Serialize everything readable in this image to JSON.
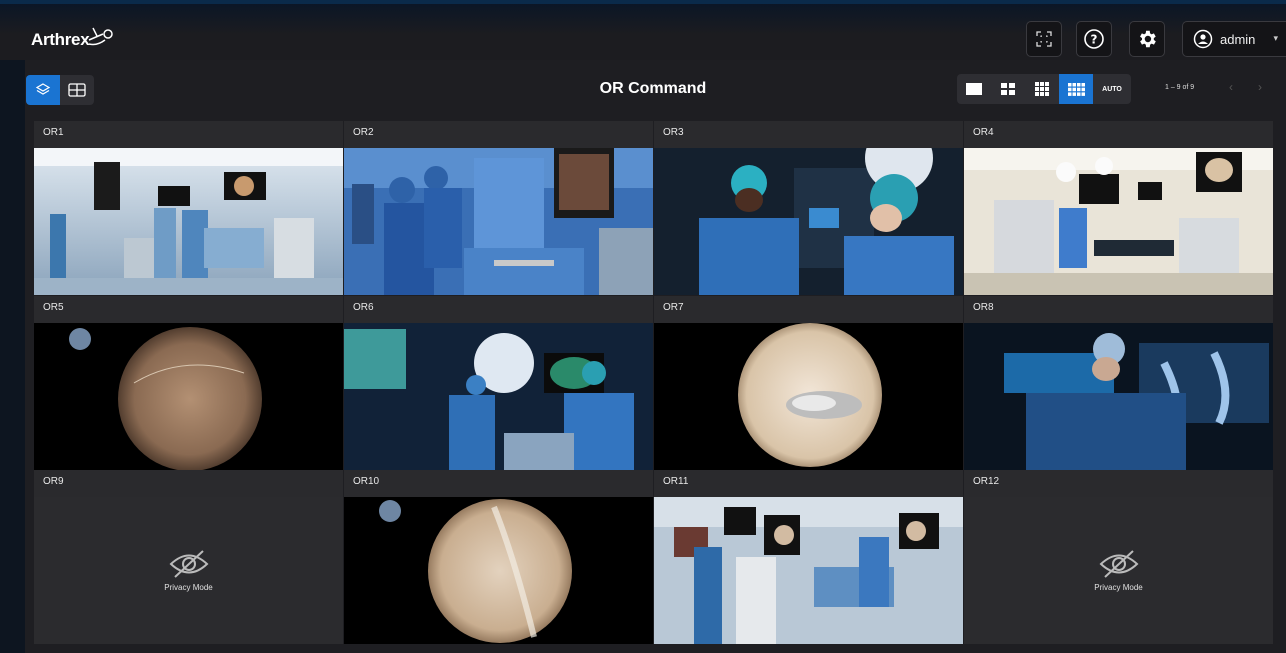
{
  "header": {
    "brand": "Arthrex",
    "user": "admin"
  },
  "page": {
    "title": "OR Command",
    "layout_auto_label": "AUTO",
    "pagination": "1 – 9 of 9"
  },
  "rooms": [
    {
      "label": "OR1",
      "mode": "video"
    },
    {
      "label": "OR2",
      "mode": "video"
    },
    {
      "label": "OR3",
      "mode": "video"
    },
    {
      "label": "OR4",
      "mode": "video"
    },
    {
      "label": "OR5",
      "mode": "endoscope"
    },
    {
      "label": "OR6",
      "mode": "video"
    },
    {
      "label": "OR7",
      "mode": "endoscope"
    },
    {
      "label": "OR8",
      "mode": "video"
    },
    {
      "label": "OR9",
      "mode": "privacy",
      "status": "Privacy Mode"
    },
    {
      "label": "OR10",
      "mode": "endoscope"
    },
    {
      "label": "OR11",
      "mode": "video"
    },
    {
      "label": "OR12",
      "mode": "privacy",
      "status": "Privacy Mode"
    }
  ],
  "icons": {
    "fullscreen": "fullscreen-icon",
    "help": "help-icon",
    "settings": "gear-icon",
    "user": "user-icon",
    "layers": "layers-icon",
    "grid": "grid-icon",
    "privacy": "eye-off-icon"
  },
  "colors": {
    "accent": "#1a74d2",
    "tile_bg": "#2a2a2d",
    "panel_bg": "#1e1e22"
  }
}
